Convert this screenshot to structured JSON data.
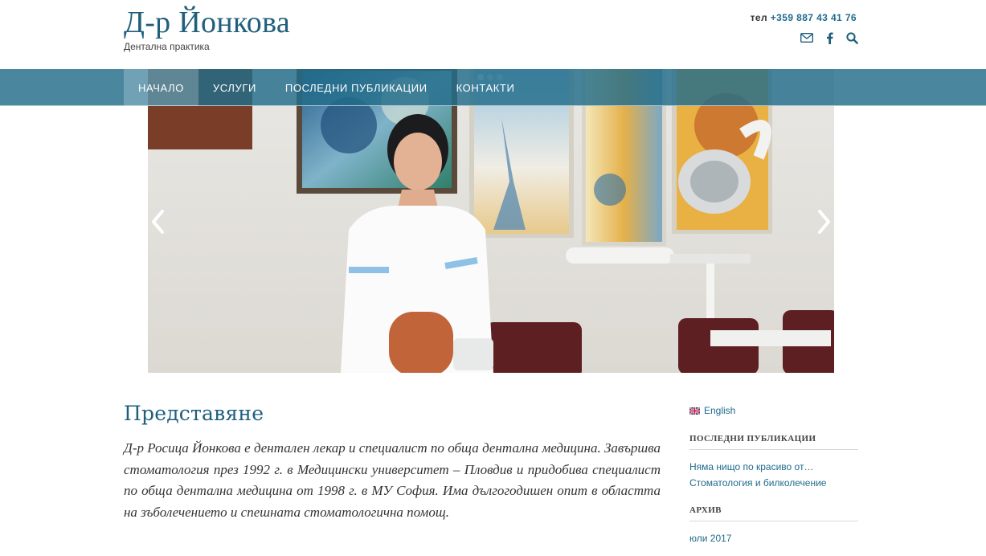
{
  "header": {
    "site_title": "Д-р Йонкова",
    "tagline": "Дентална практика",
    "phone_label": "тел",
    "phone_number": "+359 887 43 41 76",
    "icons": [
      "envelope-icon",
      "facebook-icon",
      "search-icon"
    ]
  },
  "nav": {
    "items": [
      {
        "label": "НАЧАЛО",
        "active": true
      },
      {
        "label": "УСЛУГИ",
        "active": false
      },
      {
        "label": "ПОСЛЕДНИ ПУБЛИКАЦИИ",
        "active": false
      },
      {
        "label": "КОНТАКТИ",
        "active": false
      }
    ]
  },
  "slider": {
    "dot_count": 3,
    "active_dot": 0
  },
  "main": {
    "heading": "Представяне",
    "paragraph": "Д-р Росица Йонкова е дентален лекар и специалист по обща дентална медицина. Завършва стоматология през 1992 г. в Медицински университет – Пловдив и придобива специалист по обща дентална медицина от 1998 г. в МУ София. Има дългогодишен опит в областта на зъболечението и спешната стоматологична помощ."
  },
  "sidebar": {
    "language_link": "English",
    "recent_posts_title": "ПОСЛЕДНИ ПУБЛИКАЦИИ",
    "recent_posts": [
      "Няма нищо по красиво от…",
      "Стоматология и билколечение"
    ],
    "archive_title": "АРХИВ",
    "archive": [
      "юли 2017"
    ]
  },
  "colors": {
    "brand": "#1f5f7c",
    "nav_bg": "#226c8a",
    "link": "#1f6b8c"
  }
}
